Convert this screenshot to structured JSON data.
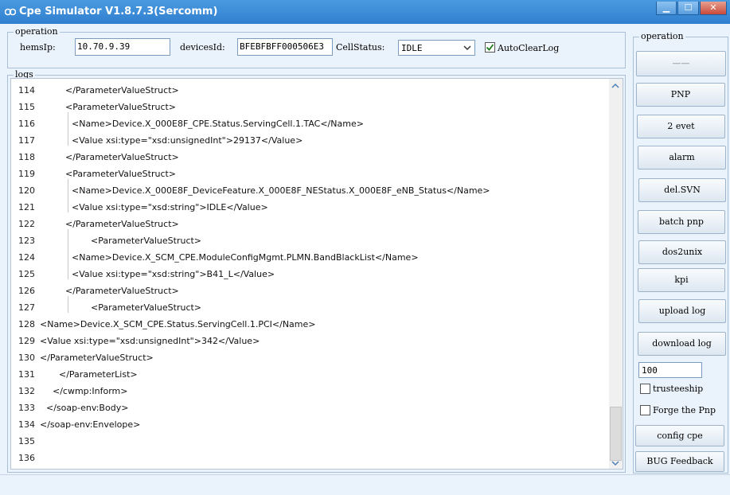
{
  "window": {
    "title": "Cpe Simulator V1.8.7.3(Sercomm)",
    "controls": {
      "minimize": "▁",
      "maximize": "☐",
      "close": "✕"
    }
  },
  "operation": {
    "legend": "operation",
    "hemsip_label": "hemsIp:",
    "hemsip_value": "10.70.9.39",
    "devicesid_label": "devicesId:",
    "devicesid_value": "BFEBFBFF000506E3",
    "cellstatus_label": "CellStatus:",
    "cellstatus_value": "IDLE",
    "autoclearlog_label": "AutoClearLog",
    "autoclearlog_checked": true
  },
  "logs": {
    "legend": "logs",
    "lines": [
      {
        "num": "114",
        "text": "</ParameterValueStruct>"
      },
      {
        "num": "115",
        "text": "<ParameterValueStruct>"
      },
      {
        "num": "116",
        "text": "<Name>Device.X_000E8F_CPE.Status.ServingCell.1.TAC</Name>"
      },
      {
        "num": "117",
        "text": "<Value xsi:type=\"xsd:unsignedInt\">29137</Value>"
      },
      {
        "num": "118",
        "text": "</ParameterValueStruct>"
      },
      {
        "num": "119",
        "text": "<ParameterValueStruct>"
      },
      {
        "num": "120",
        "text": "<Name>Device.X_000E8F_DeviceFeature.X_000E8F_NEStatus.X_000E8F_eNB_Status</Name>"
      },
      {
        "num": "121",
        "text": "<Value xsi:type=\"xsd:string\">IDLE</Value>"
      },
      {
        "num": "122",
        "text": "</ParameterValueStruct>"
      },
      {
        "num": "123",
        "text": "<ParameterValueStruct>"
      },
      {
        "num": "124",
        "text": "<Name>Device.X_SCM_CPE.ModuleConfigMgmt.PLMN.BandBlackList</Name>"
      },
      {
        "num": "125",
        "text": "<Value xsi:type=\"xsd:string\">B41_L</Value>"
      },
      {
        "num": "126",
        "text": "</ParameterValueStruct>"
      },
      {
        "num": "127",
        "text": "<ParameterValueStruct>"
      },
      {
        "num": "128",
        "text": "<Name>Device.X_SCM_CPE.Status.ServingCell.1.PCI</Name>"
      },
      {
        "num": "129",
        "text": "<Value xsi:type=\"xsd:unsignedInt\">342</Value>"
      },
      {
        "num": "130",
        "text": "</ParameterValueStruct>"
      },
      {
        "num": "131",
        "text": "</ParameterList>"
      },
      {
        "num": "132",
        "text": "</cwmp:Inform>"
      },
      {
        "num": "133",
        "text": "</soap-env:Body>"
      },
      {
        "num": "134",
        "text": "</soap-env:Envelope>"
      },
      {
        "num": "135",
        "text": ""
      },
      {
        "num": "136",
        "text": ""
      }
    ]
  },
  "panel": {
    "legend": "operation",
    "buttons": {
      "blank": "——",
      "pnp": "PNP",
      "two_evet": "2 evet",
      "alarm": "alarm",
      "del_svn": "del.SVN",
      "batch_pnp": "batch pnp",
      "dos2unix": "dos2unix",
      "kpi": "kpi",
      "upload_log": "upload log",
      "download_log": "download log",
      "config_cpe": "config cpe",
      "bug_feedback": "BUG Feedback"
    },
    "count_value": "100",
    "trusteeship_label": "trusteeship",
    "forge_pnp_label": "Forge the Pnp"
  }
}
